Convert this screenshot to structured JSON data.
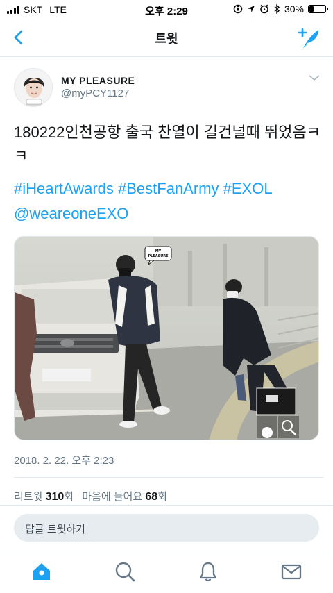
{
  "status_bar": {
    "carrier": "SKT",
    "network": "LTE",
    "time": "오후 2:29",
    "battery_text": "30%",
    "battery_level": 0.3
  },
  "nav": {
    "title": "트윗"
  },
  "tweet": {
    "user_name": "MY PLEASURE",
    "handle": "@myPCY1127",
    "text": "180222인천공항 출국 찬열이 길건널때 뛰었음ㅋㅋ",
    "hashtags": [
      "#iHeartAwards",
      "#BestFanArmy",
      "#EXOL"
    ],
    "mention": "@weareoneEXO",
    "date": "2018. 2. 22. 오후 2:23",
    "watermark_logo": "MY PLEASURE"
  },
  "stats": {
    "retweet_label": "리트윗",
    "retweet_count": "310",
    "retweet_suffix": "회",
    "like_label": "마음에 들어요",
    "like_count": "68",
    "like_suffix": "회"
  },
  "reply": {
    "placeholder": "답글 트윗하기"
  },
  "colors": {
    "accent": "#1da1f2",
    "secondary_text": "#657786",
    "tab_icon": "#657786"
  },
  "icons": [
    "back-chevron-icon",
    "compose-tweet-icon",
    "more-chevron-icon",
    "home-icon",
    "search-icon",
    "notifications-bell-icon",
    "messages-envelope-icon"
  ]
}
